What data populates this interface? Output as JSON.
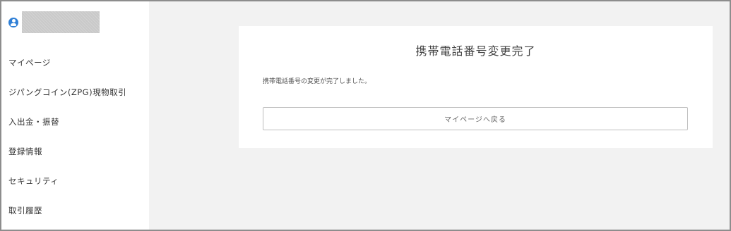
{
  "sidebar": {
    "user_icon": "user-circle-icon",
    "user_name": "",
    "items": [
      {
        "label": "マイページ"
      },
      {
        "label": "ジパングコイン(ZPG)現物取引"
      },
      {
        "label": "入出金・振替"
      },
      {
        "label": "登録情報"
      },
      {
        "label": "セキュリティ"
      },
      {
        "label": "取引履歴"
      }
    ]
  },
  "main": {
    "title": "携帯電話番号変更完了",
    "message": "携帯電話番号の変更が完了しました。",
    "back_button_label": "マイページへ戻る"
  },
  "colors": {
    "accent": "#2f7fd6",
    "background": "#f2f2f2",
    "card": "#ffffff"
  }
}
